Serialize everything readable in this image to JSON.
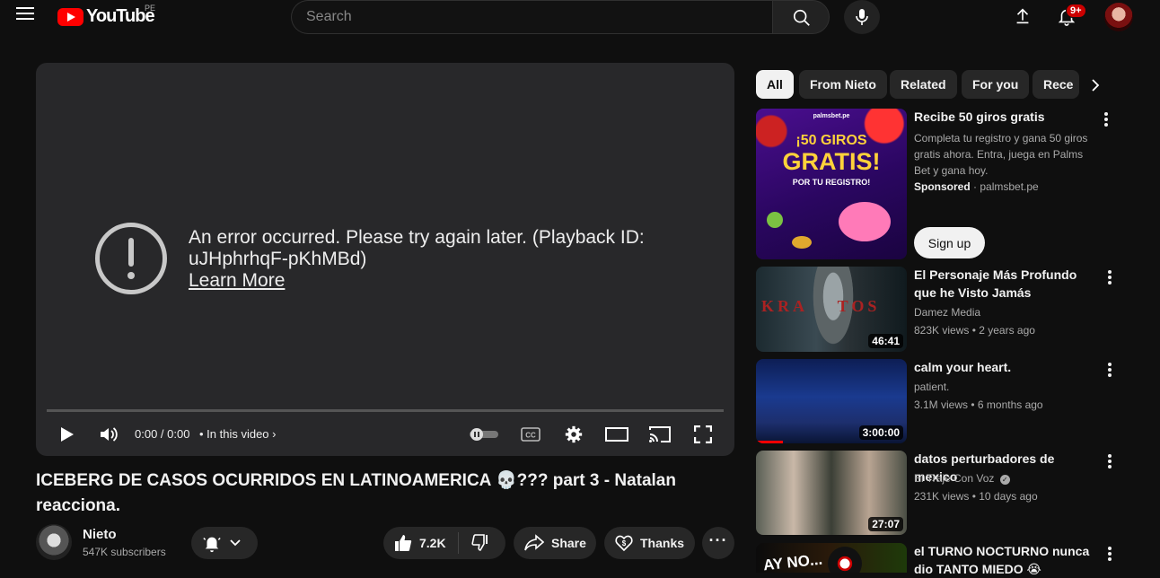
{
  "header": {
    "logo_text": "YouTube",
    "region": "PE",
    "search_placeholder": "Search",
    "notifications_badge": "9+"
  },
  "player": {
    "error_message": "An error occurred. Please try again later. (Playback ID: uJHphrhqF-pKhMBd)",
    "learn_more": "Learn More",
    "time": "0:00 / 0:00",
    "chapter_label": "• In this video"
  },
  "video": {
    "title": "ICEBERG DE CASOS OCURRIDOS EN LATINOAMERICA 💀??? part 3 - Natalan reacciona.",
    "channel_name": "Nieto",
    "subscribers": "547K subscribers",
    "likes": "7.2K",
    "share_label": "Share",
    "thanks_label": "Thanks"
  },
  "chips": [
    "All",
    "From Nieto",
    "Related",
    "For you",
    "Rece"
  ],
  "sidebar": {
    "ad": {
      "title": "Recibe 50 giros gratis",
      "description": "Completa tu registro y gana 50 giros gratis ahora. Entra, juega en Palms Bet y gana hoy.",
      "sponsored": "Sponsored",
      "domain": "· palmsbet.pe",
      "cta": "Sign up",
      "thumb_brand": "palmsbet.pe",
      "thumb_line1": "¡50 GIROS",
      "thumb_line2": "GRATIS!",
      "thumb_line3": "POR TU REGISTRO!"
    },
    "videos": [
      {
        "title": "El Personaje Más Profundo que he Visto Jamás",
        "channel": "Damez Media",
        "meta": "823K views • 2 years ago",
        "duration": "46:41",
        "thumb_text": "KRA    TOS"
      },
      {
        "title": "calm your heart.",
        "channel": "patient.",
        "meta": "3.1M views • 6 months ago",
        "duration": "3:00:00"
      },
      {
        "title": "datos perturbadores de mexico",
        "channel": "El Traje Con Voz",
        "meta": "231K views • 10 days ago",
        "duration": "27:07"
      },
      {
        "title": "el TURNO NOCTURNO nunca dio TANTO MIEDO 😭",
        "thumb_text": "AY NO..."
      }
    ]
  }
}
